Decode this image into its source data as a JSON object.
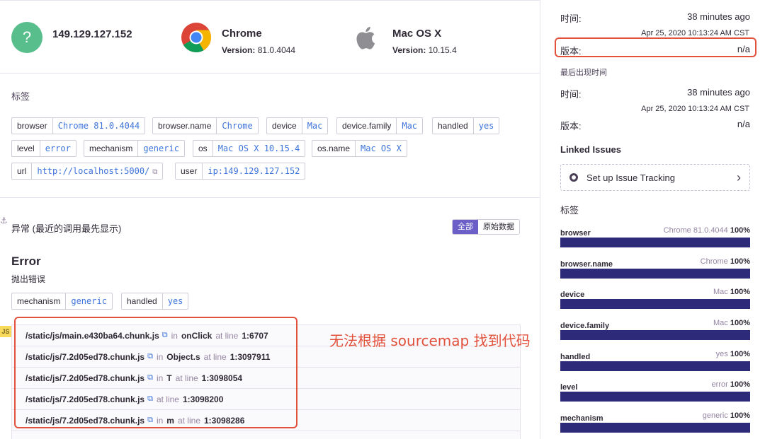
{
  "context": {
    "user": {
      "title": "149.129.127.152",
      "icon": "unknown-user-icon",
      "glyph": "?"
    },
    "browser": {
      "title": "Chrome",
      "version_label": "Version:",
      "version": "81.0.4044",
      "icon": "chrome-icon"
    },
    "os": {
      "title": "Mac OS X",
      "version_label": "Version:",
      "version": "10.15.4",
      "icon": "apple-icon"
    }
  },
  "tags": {
    "heading": "标签",
    "items": [
      {
        "key": "browser",
        "value": "Chrome 81.0.4044"
      },
      {
        "key": "browser.name",
        "value": "Chrome"
      },
      {
        "key": "device",
        "value": "Mac"
      },
      {
        "key": "device.family",
        "value": "Mac"
      },
      {
        "key": "handled",
        "value": "yes"
      },
      {
        "key": "level",
        "value": "error"
      },
      {
        "key": "mechanism",
        "value": "generic"
      },
      {
        "key": "os",
        "value": "Mac OS X 10.15.4"
      },
      {
        "key": "os.name",
        "value": "Mac OS X"
      },
      {
        "key": "url",
        "value": "http://localhost:5000/"
      },
      {
        "key": "user",
        "value": "ip:149.129.127.152"
      }
    ]
  },
  "exception": {
    "anchor": "⚓",
    "title": "异常 (最近的调用最先显示)",
    "buttons": [
      "全部",
      "原始数据"
    ],
    "type": "Error",
    "message": "抛出错误",
    "tags": [
      {
        "key": "mechanism",
        "value": "generic"
      },
      {
        "key": "handled",
        "value": "yes"
      }
    ],
    "platform_badge": "JS",
    "frames": [
      {
        "file": "/static/js/main.e430ba64.chunk.js",
        "in": "in",
        "fn": "onClick",
        "at": "at line",
        "line": "1:6707"
      },
      {
        "file": "/static/js/7.2d05ed78.chunk.js",
        "in": "in",
        "fn": "Object.s",
        "at": "at line",
        "line": "1:3097911"
      },
      {
        "file": "/static/js/7.2d05ed78.chunk.js",
        "in": "in",
        "fn": "T",
        "at": "at line",
        "line": "1:3098054"
      },
      {
        "file": "/static/js/7.2d05ed78.chunk.js",
        "in": "",
        "fn": "",
        "at": "at line",
        "line": "1:3098200"
      },
      {
        "file": "/static/js/7.2d05ed78.chunk.js",
        "in": "in",
        "fn": "m",
        "at": "at line",
        "line": "1:3098286"
      }
    ],
    "annotation": "无法根据 sourcemap 找到代码"
  },
  "sidebar": {
    "first_seen": {
      "time_label": "时间:",
      "time": "38 minutes ago",
      "date": "Apr 25, 2020 10:13:24 AM CST",
      "release_label": "版本:",
      "release": "n/a"
    },
    "last_seen_heading": "最后出现时间",
    "last_seen": {
      "time_label": "时间:",
      "time": "38 minutes ago",
      "date": "Apr 25, 2020 10:13:24 AM CST",
      "release_label": "版本:",
      "release": "n/a"
    },
    "linked_issues_heading": "Linked Issues",
    "issue_tracking_label": "Set up Issue Tracking",
    "tags_heading": "标签",
    "tag_dist": [
      {
        "name": "browser",
        "top": "Chrome 81.0.4044",
        "pct": "100%",
        "fraction": 1.0
      },
      {
        "name": "browser.name",
        "top": "Chrome",
        "pct": "100%",
        "fraction": 1.0
      },
      {
        "name": "device",
        "top": "Mac",
        "pct": "100%",
        "fraction": 1.0
      },
      {
        "name": "device.family",
        "top": "Mac",
        "pct": "100%",
        "fraction": 1.0
      },
      {
        "name": "handled",
        "top": "yes",
        "pct": "100%",
        "fraction": 1.0
      },
      {
        "name": "level",
        "top": "error",
        "pct": "100%",
        "fraction": 1.0
      },
      {
        "name": "mechanism",
        "top": "generic",
        "pct": "100%",
        "fraction": 1.0
      }
    ]
  },
  "colors": {
    "accent": "#6c5fc7",
    "link": "#3d74db",
    "annotation": "#e2513c",
    "bar": "#2e2a7a"
  }
}
